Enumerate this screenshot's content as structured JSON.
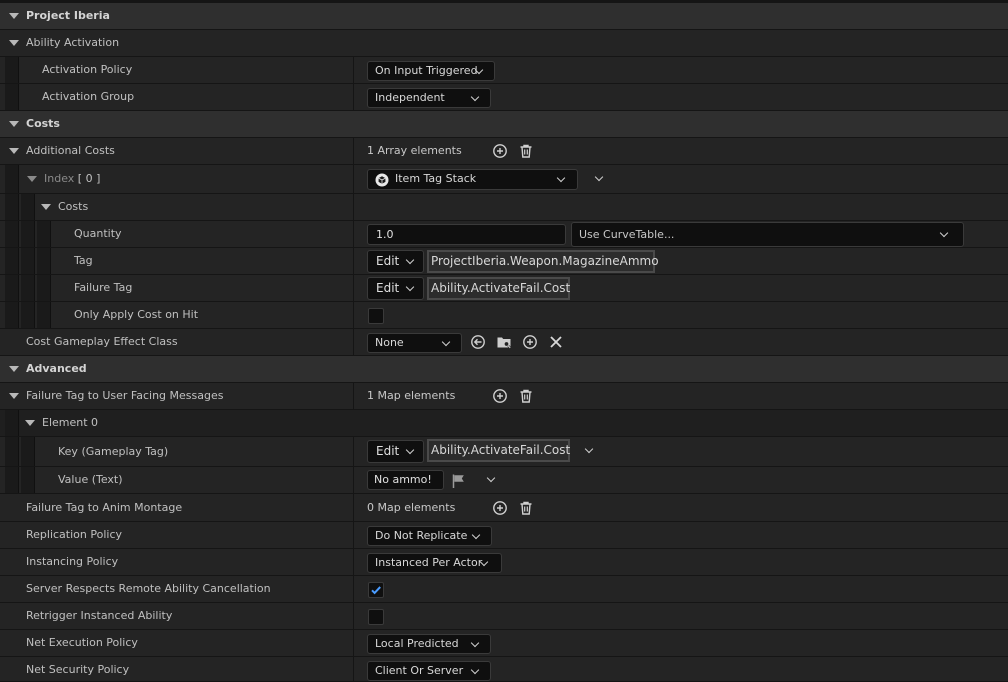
{
  "sections": {
    "project_iberia": "Project Iberia",
    "ability_activation": "Ability Activation",
    "costs": "Costs",
    "advanced": "Advanced"
  },
  "activation": {
    "policy_label": "Activation Policy",
    "policy_value": "On Input Triggered",
    "group_label": "Activation Group",
    "group_value": "Independent"
  },
  "costs": {
    "additional_label": "Additional Costs",
    "additional_count": "1 Array elements",
    "index_label": "Index",
    "index_value": "[ 0 ]",
    "index_type": "Item Tag Stack",
    "inner_label": "Costs",
    "quantity_label": "Quantity",
    "quantity_value": "1.0",
    "curve_placeholder": "Use CurveTable...",
    "tag_label": "Tag",
    "tag_edit": "Edit",
    "tag_value": "ProjectIberia.Weapon.MagazineAmmo",
    "failure_tag_label": "Failure Tag",
    "failure_tag_edit": "Edit",
    "failure_tag_value": "Ability.ActivateFail.Cost",
    "only_apply_label": "Only Apply Cost on Hit",
    "only_apply_checked": false,
    "effect_class_label": "Cost Gameplay Effect Class",
    "effect_class_value": "None"
  },
  "advanced": {
    "failure_msgs_label": "Failure Tag to User Facing Messages",
    "failure_msgs_count": "1 Map elements",
    "element_label": "Element 0",
    "key_label": "Key (Gameplay Tag)",
    "key_edit": "Edit",
    "key_value": "Ability.ActivateFail.Cost",
    "value_label": "Value (Text)",
    "value_text": "No ammo!",
    "anim_label": "Failure Tag to Anim Montage",
    "anim_count": "0 Map elements",
    "replication_label": "Replication Policy",
    "replication_value": "Do Not Replicate",
    "instancing_label": "Instancing Policy",
    "instancing_value": "Instanced Per Actor",
    "server_cancel_label": "Server Respects Remote Ability Cancellation",
    "server_cancel_checked": true,
    "retrigger_label": "Retrigger Instanced Ability",
    "retrigger_checked": false,
    "net_exec_label": "Net Execution Policy",
    "net_exec_value": "Local Predicted",
    "net_sec_label": "Net Security Policy",
    "net_sec_value": "Client Or Server"
  },
  "colors": {
    "background": "#151515",
    "row": "#242424",
    "category": "#2f2f2f",
    "accent_check": "#4a9cff"
  }
}
